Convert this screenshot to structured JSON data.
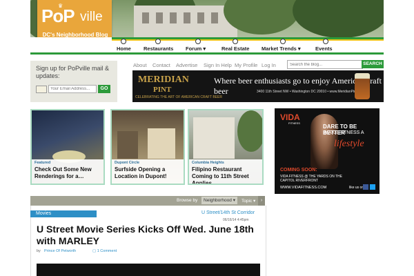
{
  "site": {
    "logo_main": "PoP",
    "logo_tail": "ville",
    "tagline": "DC's Neighborhood Blog"
  },
  "nav": {
    "items": [
      {
        "label": "Home"
      },
      {
        "label": "Restaurants"
      },
      {
        "label": "Forum ▾"
      },
      {
        "label": "Real Estate"
      },
      {
        "label": "Market Trends ▾"
      },
      {
        "label": "Events"
      }
    ]
  },
  "signup": {
    "text": "Sign up for PoPville mail & updates:",
    "placeholder": "Your Email Address...",
    "button": "GO"
  },
  "toplinks": [
    "About",
    "Contact",
    "Advertise",
    "Sign In Help",
    "My Profile",
    "Log In"
  ],
  "search": {
    "placeholder": "Search the blog...",
    "button": "SEARCH"
  },
  "banner_ad": {
    "brand_line1": "MERIDIAN",
    "brand_line2": "PINT",
    "brand_sub": "CELEBRATING THE ART OF AMERICAN CRAFT BEER",
    "headline": "Where beer enthusiasts go to enjoy American craft beer",
    "address": "3400 11th Street NW • Washington DC 20010 • www.MeridianPint.com"
  },
  "stories": [
    {
      "tag": "Featured",
      "title": "Check Out Some New Renderings for a…"
    },
    {
      "tag": "Dupont Circle",
      "title": "Surfside Opening a Location in Dupont!"
    },
    {
      "tag": "Columbia Heights",
      "title": "Filipino Restaurant Coming to 11th Street Applies…"
    }
  ],
  "vida_ad": {
    "brand": "VIDA",
    "brand_sub": "FITNESS",
    "line1": "DARE TO BE BETTER",
    "line2": "MAKE FITNESS A",
    "line3": "lifestyle",
    "coming": "COMING SOON:",
    "coming_detail": "VIDA FITNESS @ THE YARDS ON THE CAPITOL RIVERFRONT",
    "url": "WWW.VIDAFITNESS.COM",
    "follow": "like us on"
  },
  "browse": {
    "label": "Browse by",
    "neighborhood": "Neighborhood ▾",
    "topic": "Topic ▾",
    "arrow": "›"
  },
  "article": {
    "category": "Movies",
    "location": "U Street/14th St Corridor",
    "date": "06/16/14 4:45pm",
    "headline": "U Street Movie Series Kicks Off Wed. June 18th with MARLEY",
    "by": "by",
    "author": "Prince Of Petworth",
    "comments": "▢ 1 Comment"
  },
  "colors": {
    "brand_orange": "#e9a63b",
    "nav_green": "#2c9a3a",
    "nav_yellow": "#f0c419",
    "link_blue": "#2d8fc6",
    "story_border": "#a9dbc1"
  }
}
